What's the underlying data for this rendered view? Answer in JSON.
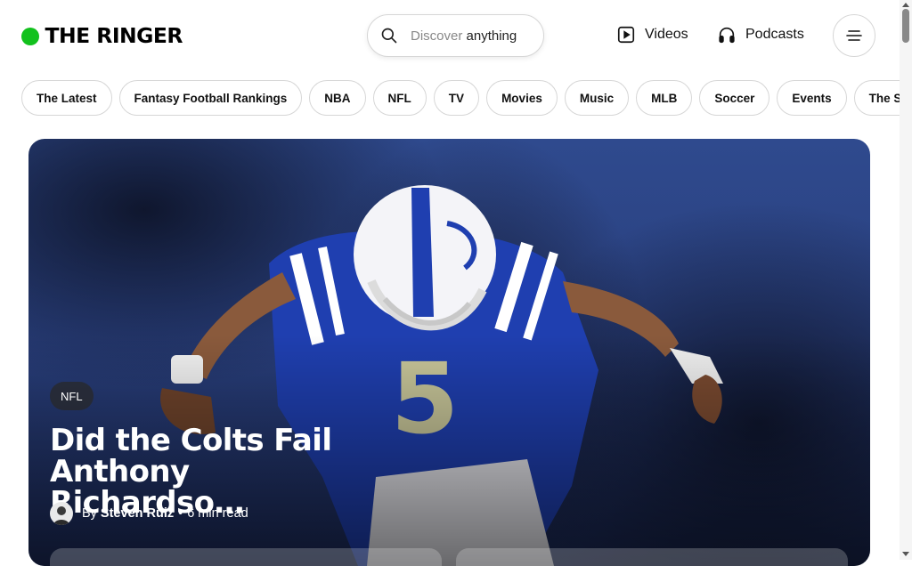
{
  "brand": {
    "name": "THE RINGER",
    "accent": "#12c11d"
  },
  "search": {
    "prefix": "Discover",
    "suffix": "anything",
    "icon": "search-icon"
  },
  "nav": {
    "videos": {
      "label": "Videos",
      "icon": "play-video-icon"
    },
    "podcasts": {
      "label": "Podcasts",
      "icon": "headphones-icon"
    },
    "menu": {
      "icon": "hamburger-menu-icon"
    }
  },
  "chips": [
    "The Latest",
    "Fantasy Football Rankings",
    "NBA",
    "NFL",
    "TV",
    "Movies",
    "Music",
    "MLB",
    "Soccer",
    "Events",
    "The Stream"
  ],
  "hero": {
    "tag": "NFL",
    "headline": "Did the Colts Fail Anthony Richardso…",
    "by": "By",
    "author": "Steven Ruiz",
    "separator": "•",
    "read_time": "6 min read",
    "background": "#2a4180",
    "jersey_number": "5"
  }
}
